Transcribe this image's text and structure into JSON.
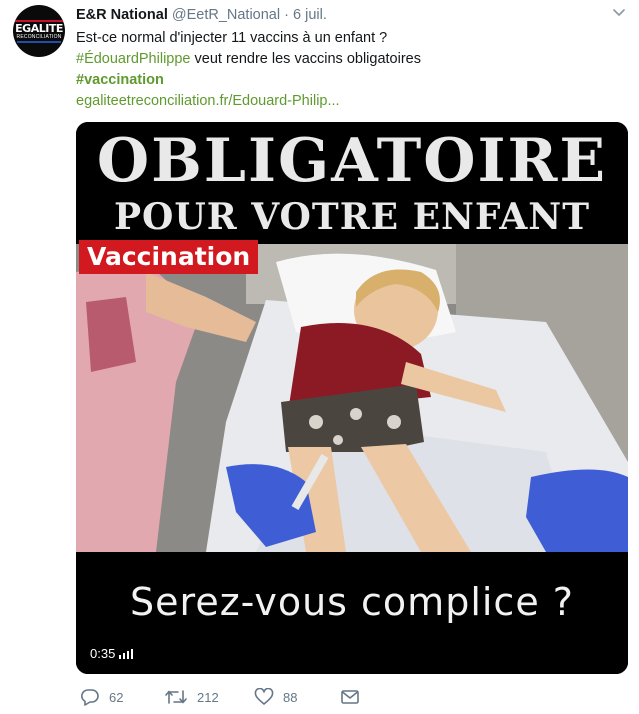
{
  "account": {
    "avatar_text_top": "EGALITE",
    "avatar_text_bottom": "RECONCILIATION",
    "display_name": "E&R National",
    "handle": "@EetR_National",
    "separator": "·",
    "date": "6 juil."
  },
  "tweet": {
    "line1": "Est-ce normal d'injecter 11 vaccins à un enfant ?",
    "hashtag_mention": "#ÉdouardPhilippe",
    "line2_rest": " veut rendre les vaccins obligatoires",
    "hashtag": "#vaccination",
    "link": "egaliteetreconciliation.fr/Edouard-Philip..."
  },
  "media": {
    "headline_top": "OBLIGATOIRE",
    "headline_bottom": "POUR VOTRE ENFANT",
    "badge": "Vaccination",
    "caption": "Serez-vous complice ?",
    "duration": "0:35"
  },
  "actions": {
    "replies": "62",
    "retweets": "212",
    "likes": "88"
  },
  "icons": {
    "reply": "reply-icon",
    "retweet": "retweet-icon",
    "like": "heart-icon",
    "dm": "envelope-icon",
    "menu": "chevron-down-icon",
    "volume": "volume-icon"
  },
  "colors": {
    "link_green": "#5f9a2f",
    "meta_grey": "#657786",
    "badge_red": "#d31920"
  }
}
